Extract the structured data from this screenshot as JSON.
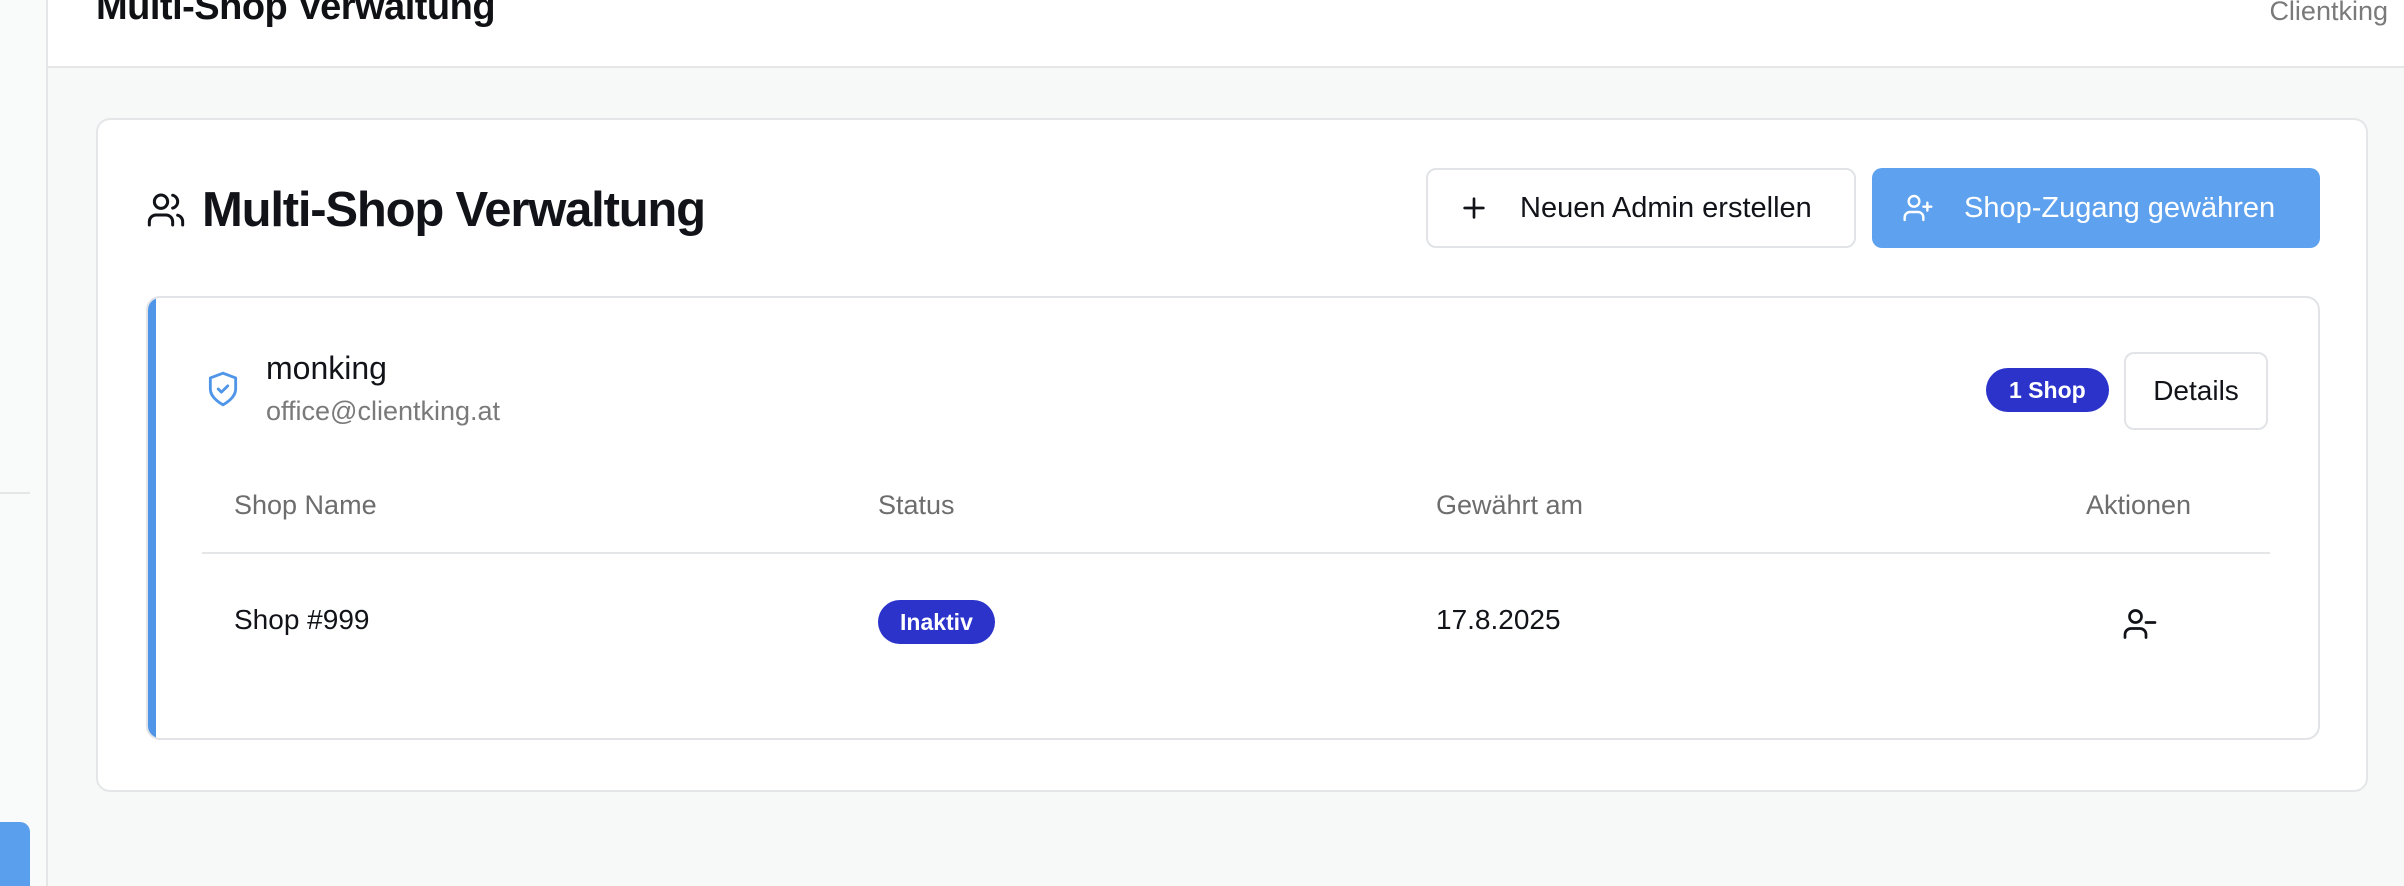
{
  "topbar": {
    "title": "Multi-Shop Verwaltung",
    "user": "Clientking"
  },
  "card": {
    "title": "Multi-Shop Verwaltung",
    "title_icon": "users-icon",
    "buttons": {
      "new_admin": {
        "label": "Neuen Admin erstellen",
        "icon": "plus-icon"
      },
      "grant_access": {
        "label": "Shop-Zugang gewähren",
        "icon": "user-plus-icon"
      }
    }
  },
  "admin": {
    "icon": "shield-check-icon",
    "name": "monking",
    "email": "office@clientking.at",
    "shop_count_badge": "1 Shop",
    "details_label": "Details",
    "table": {
      "headers": [
        "Shop Name",
        "Status",
        "Gewährt am",
        "Aktionen"
      ],
      "rows": [
        {
          "shop_name": "Shop #999",
          "status": "Inaktiv",
          "granted_at": "17.8.2025",
          "action_icon": "user-minus-icon"
        }
      ]
    }
  },
  "colors": {
    "primary": "#5ea1ee",
    "accent_border": "#4f95e8",
    "badge": "#2b33cb",
    "shield": "#4f95e8"
  }
}
